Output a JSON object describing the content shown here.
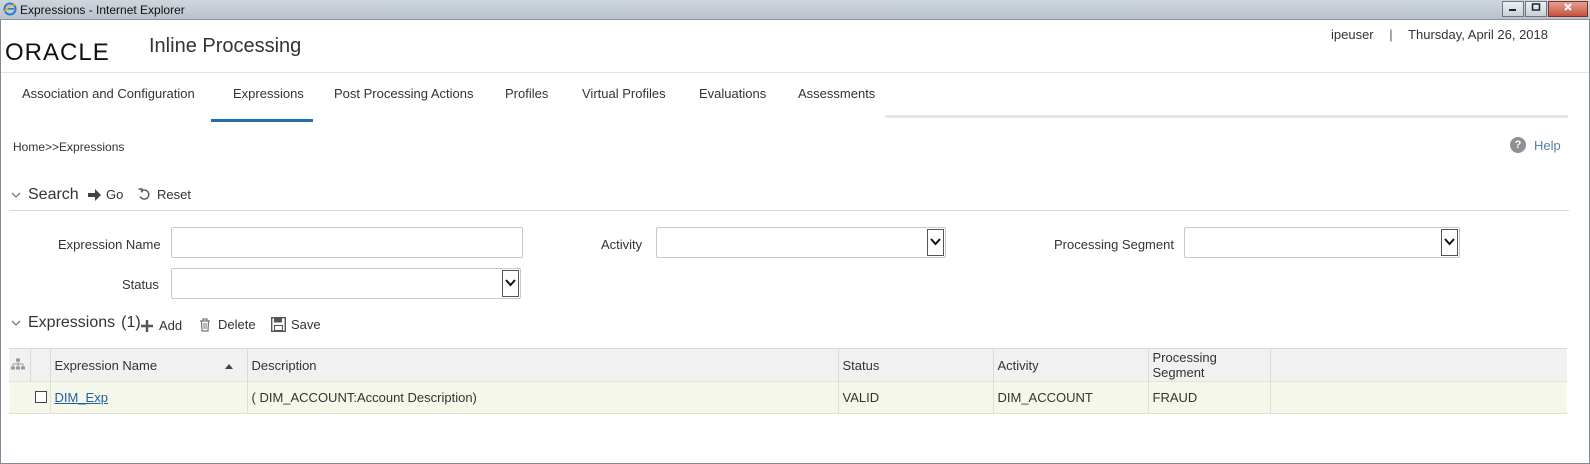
{
  "window": {
    "title": "Expressions - Internet Explorer",
    "buttons": [
      "minimize",
      "maximize",
      "close"
    ]
  },
  "header": {
    "logo_text": "ORACLE",
    "app_title": "Inline Processing",
    "user": "ipeuser",
    "separator": "|",
    "date": "Thursday, April 26, 2018"
  },
  "nav": {
    "tabs": [
      {
        "label": "Association and Configuration",
        "active": false
      },
      {
        "label": "Expressions",
        "active": true
      },
      {
        "label": "Post Processing Actions",
        "active": false
      },
      {
        "label": "Profiles",
        "active": false
      },
      {
        "label": "Virtual Profiles",
        "active": false
      },
      {
        "label": "Evaluations",
        "active": false
      },
      {
        "label": "Assessments",
        "active": false
      }
    ],
    "accent_color": "#1f6fb5"
  },
  "breadcrumb": {
    "home": "Home",
    "separator": ">>",
    "current": "Expressions"
  },
  "help": {
    "icon": "?",
    "label": "Help"
  },
  "search": {
    "title": "Search",
    "go_label": "Go",
    "reset_label": "Reset",
    "fields": {
      "expression_name": {
        "label": "Expression Name",
        "value": ""
      },
      "activity": {
        "label": "Activity",
        "value": ""
      },
      "processing_segment": {
        "label": "Processing Segment",
        "value": ""
      },
      "status": {
        "label": "Status",
        "value": ""
      }
    }
  },
  "expressions": {
    "title": "Expressions",
    "count": "(1)",
    "add_label": "Add",
    "delete_label": "Delete",
    "save_label": "Save",
    "columns": [
      "Expression Name",
      "Description",
      "Status",
      "Activity",
      "Processing Segment"
    ],
    "rows": [
      {
        "expression_name": "DIM_Exp",
        "description": "( DIM_ACCOUNT:Account Description)",
        "status": "VALID",
        "activity": "DIM_ACCOUNT",
        "processing_segment": "FRAUD"
      }
    ]
  }
}
